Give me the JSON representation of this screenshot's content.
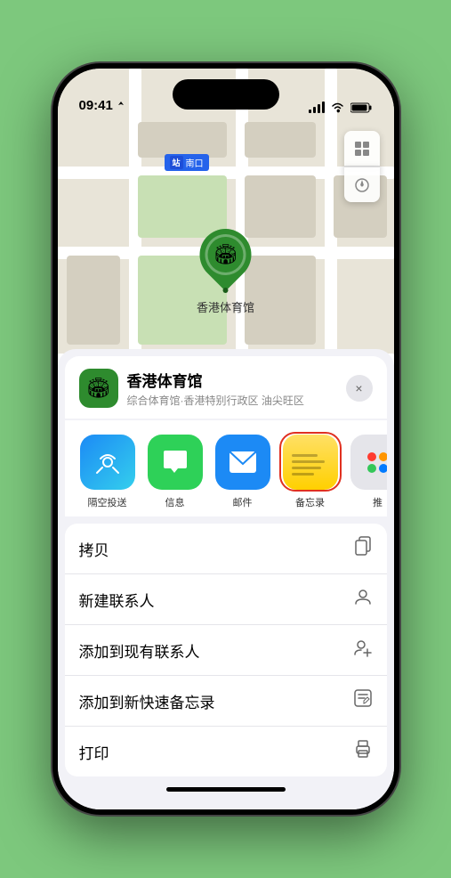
{
  "status_bar": {
    "time": "09:41",
    "location_icon": "▶"
  },
  "map": {
    "subway_label": "南口",
    "venue_pin_label": "香港体育馆"
  },
  "map_controls": {
    "map_icon": "🗺",
    "location_icon": "⬆"
  },
  "venue": {
    "name": "香港体育馆",
    "subtitle": "综合体育馆·香港特别行政区 油尖旺区",
    "icon": "🏟"
  },
  "share_items": [
    {
      "id": "airdrop",
      "label": "隔空投送",
      "type": "airdrop"
    },
    {
      "id": "messages",
      "label": "信息",
      "type": "messages"
    },
    {
      "id": "mail",
      "label": "邮件",
      "type": "mail"
    },
    {
      "id": "notes",
      "label": "备忘录",
      "type": "notes"
    },
    {
      "id": "more",
      "label": "推",
      "type": "more-apps"
    }
  ],
  "actions": [
    {
      "label": "拷贝",
      "icon": "copy"
    },
    {
      "label": "新建联系人",
      "icon": "person"
    },
    {
      "label": "添加到现有联系人",
      "icon": "person-add"
    },
    {
      "label": "添加到新快速备忘录",
      "icon": "note"
    },
    {
      "label": "打印",
      "icon": "printer"
    }
  ],
  "close_label": "×"
}
